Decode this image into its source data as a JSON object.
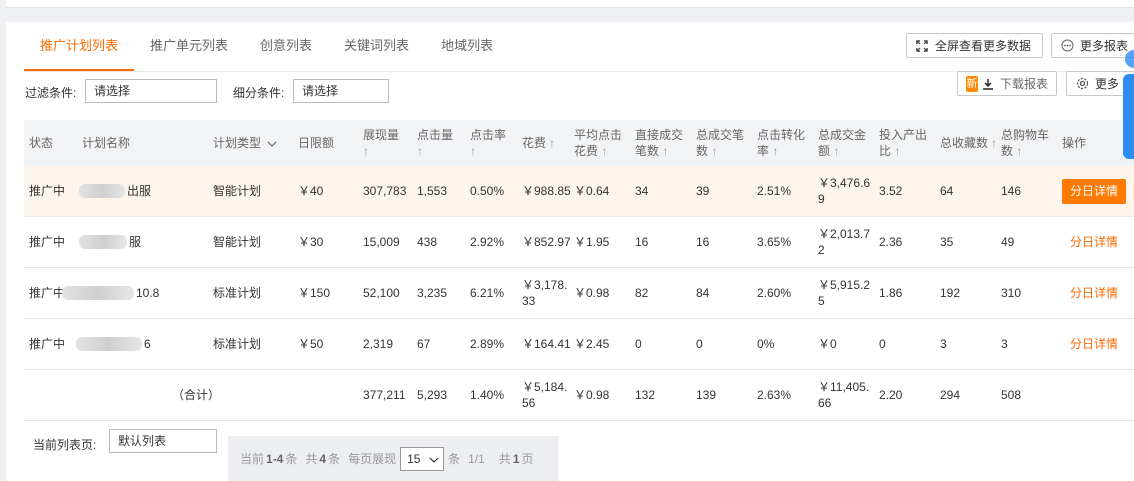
{
  "tabs": [
    "推广计划列表",
    "推广单元列表",
    "创意列表",
    "关键词列表",
    "地域列表"
  ],
  "toolbar": {
    "fullscreen_label": "全屏查看更多数据",
    "more_reports_label": "更多报表",
    "new_badge": "新",
    "download_label": "下载报表",
    "more_label": "更多"
  },
  "filters": {
    "filter_label": "过滤条件:",
    "filter_value": "请选择",
    "segment_label": "细分条件:",
    "segment_value": "请选择"
  },
  "table": {
    "headers": {
      "status": "状态",
      "name": "计划名称",
      "type": "计划类型",
      "budget": "日限额",
      "impressions": "展现量",
      "clicks": "点击量",
      "ctr": "点击率",
      "cost": "花费",
      "cpc": "平均点击花费",
      "direct_orders": "直接成交笔数",
      "total_orders": "总成交笔数",
      "cvr": "点击转化率",
      "total_amount": "总成交金额",
      "roi": "投入产出比",
      "favorites": "总收藏数",
      "cart": "总购物车数",
      "action": "操作"
    },
    "rows": [
      {
        "status": "推广中",
        "name": "出服",
        "type": "智能计划",
        "budget": "￥40",
        "impressions": "307,783",
        "clicks": "1,553",
        "ctr": "0.50%",
        "cost": "￥988.85",
        "cpc": "￥0.64",
        "direct_orders": "34",
        "total_orders": "39",
        "cvr": "2.51%",
        "total_amount": "￥3,476.69",
        "roi": "3.52",
        "favorites": "64",
        "cart": "146",
        "action": "分日详情"
      },
      {
        "status": "推广中",
        "name": "服",
        "type": "智能计划",
        "budget": "￥30",
        "impressions": "15,009",
        "clicks": "438",
        "ctr": "2.92%",
        "cost": "￥852.97",
        "cpc": "￥1.95",
        "direct_orders": "16",
        "total_orders": "16",
        "cvr": "3.65%",
        "total_amount": "￥2,013.72",
        "roi": "2.36",
        "favorites": "35",
        "cart": "49",
        "action": "分日详情"
      },
      {
        "status": "推广中",
        "name": "10.8",
        "type": "标准计划",
        "budget": "￥150",
        "impressions": "52,100",
        "clicks": "3,235",
        "ctr": "6.21%",
        "cost": "￥3,178.33",
        "cpc": "￥0.98",
        "direct_orders": "82",
        "total_orders": "84",
        "cvr": "2.60%",
        "total_amount": "￥5,915.25",
        "roi": "1.86",
        "favorites": "192",
        "cart": "310",
        "action": "分日详情"
      },
      {
        "status": "推广中",
        "name": "6",
        "type": "标准计划",
        "budget": "￥50",
        "impressions": "2,319",
        "clicks": "67",
        "ctr": "2.89%",
        "cost": "￥164.41",
        "cpc": "￥2.45",
        "direct_orders": "0",
        "total_orders": "0",
        "cvr": "0%",
        "total_amount": "￥0",
        "roi": "0",
        "favorites": "3",
        "cart": "3",
        "action": "分日详情"
      }
    ],
    "total": {
      "label": "（合计）",
      "impressions": "377,211",
      "clicks": "5,293",
      "ctr": "1.40%",
      "cost": "￥5,184.56",
      "cpc": "￥0.98",
      "direct_orders": "132",
      "total_orders": "139",
      "cvr": "2.63%",
      "total_amount": "￥11,405.66",
      "roi": "2.20",
      "favorites": "294",
      "cart": "508"
    }
  },
  "footer": {
    "current_list_label": "当前列表页:",
    "current_list_value": "默认列表",
    "pager": {
      "current_prefix": "当前",
      "current_range": "1-4",
      "current_suffix": "条",
      "total_prefix": "共",
      "total_count": "4",
      "total_suffix": "条",
      "per_page_label": "每页展现",
      "page_size": "15",
      "per_page_suffix": "条",
      "page_position": "1/1",
      "pages_prefix": "共",
      "pages_count": "1",
      "pages_suffix": "页"
    }
  },
  "colors": {
    "accent": "#ff6a00",
    "action_button": "#ff7a00",
    "highlight_row": "#fdf5ec",
    "header_bg": "#f2f3f5",
    "side_widget": "#2d8cf0"
  }
}
